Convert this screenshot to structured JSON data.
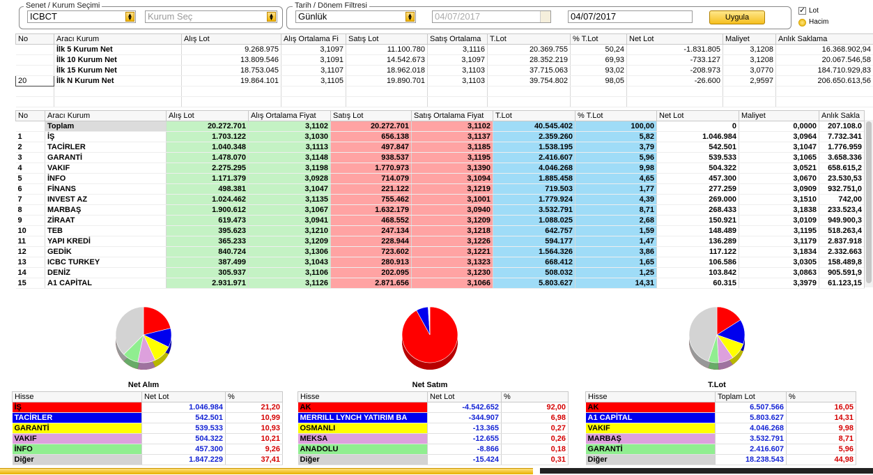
{
  "filters": {
    "security_group_title": "Senet / Kurum Seçimi",
    "security_value": "ICBCT",
    "institution_placeholder": "Kurum Seç",
    "date_group_title": "Tarih / Dönem Filtresi",
    "period_value": "Günlük",
    "start_date": "04/07/2017",
    "end_date": "04/07/2017",
    "apply_label": "Uygula",
    "option_lot_label": "Lot",
    "option_volume_label": "Hacim"
  },
  "top_table": {
    "columns": [
      "No",
      "Aracı Kurum",
      "Alış Lot",
      "Alış Ortalama Fi",
      "Satış Lot",
      "Satış Ortalama",
      "T.Lot",
      "% T.Lot",
      "Net Lot",
      "Maliyet",
      "Anlık Saklama"
    ],
    "rows": [
      {
        "no": "",
        "kurum": "İlk 5 Kurum Net",
        "alis_lot": "9.268.975",
        "alis_ort": "3,1097",
        "satis_lot": "11.100.780",
        "satis_ort": "3,1116",
        "t_lot": "20.369.755",
        "pct": "50,24",
        "net_lot": "-1.831.805",
        "maliyet": "3,1208",
        "saklama": "16.368.902,94"
      },
      {
        "no": "",
        "kurum": "İlk 10 Kurum Net",
        "alis_lot": "13.809.546",
        "alis_ort": "3,1091",
        "satis_lot": "14.542.673",
        "satis_ort": "3,1097",
        "t_lot": "28.352.219",
        "pct": "69,93",
        "net_lot": "-733.127",
        "maliyet": "3,1208",
        "saklama": "20.067.546,58"
      },
      {
        "no": "",
        "kurum": "İlk 15 Kurum Net",
        "alis_lot": "18.753.045",
        "alis_ort": "3,1107",
        "satis_lot": "18.962.018",
        "satis_ort": "3,1103",
        "t_lot": "37.715.063",
        "pct": "93,02",
        "net_lot": "-208.973",
        "maliyet": "3,0770",
        "saklama": "184.710.929,83"
      },
      {
        "no": "20",
        "kurum": "İlk N Kurum Net",
        "alis_lot": "19.864.101",
        "alis_ort": "3,1105",
        "satis_lot": "19.890.701",
        "satis_ort": "3,1103",
        "t_lot": "39.754.802",
        "pct": "98,05",
        "net_lot": "-26.600",
        "maliyet": "2,9597",
        "saklama": "206.650.613,56"
      }
    ]
  },
  "main_table": {
    "columns": [
      "No",
      "Aracı Kurum",
      "Alış Lot",
      "Alış Ortalama Fiyat",
      "Satış Lot",
      "Satış Ortalama Fiyat",
      "T.Lot",
      "% T.Lot",
      "Net Lot",
      "Maliyet",
      "Anlık Sakla"
    ],
    "total": {
      "no": "",
      "kurum": "Toplam",
      "alis_lot": "20.272.701",
      "alis_ort": "3,1102",
      "satis_lot": "20.272.701",
      "satis_ort": "3,1102",
      "t_lot": "40.545.402",
      "pct": "100,00",
      "net_lot": "0",
      "maliyet": "0,0000",
      "saklama": "207.108.0"
    },
    "rows": [
      {
        "no": "1",
        "kurum": "İŞ",
        "alis_lot": "1.703.122",
        "alis_ort": "3,1030",
        "satis_lot": "656.138",
        "satis_ort": "3,1137",
        "t_lot": "2.359.260",
        "pct": "5,82",
        "net_lot": "1.046.984",
        "maliyet": "3,0964",
        "saklama": "7.732.341"
      },
      {
        "no": "2",
        "kurum": "TACİRLER",
        "alis_lot": "1.040.348",
        "alis_ort": "3,1113",
        "satis_lot": "497.847",
        "satis_ort": "3,1185",
        "t_lot": "1.538.195",
        "pct": "3,79",
        "net_lot": "542.501",
        "maliyet": "3,1047",
        "saklama": "1.776.959"
      },
      {
        "no": "3",
        "kurum": "GARANTİ",
        "alis_lot": "1.478.070",
        "alis_ort": "3,1148",
        "satis_lot": "938.537",
        "satis_ort": "3,1195",
        "t_lot": "2.416.607",
        "pct": "5,96",
        "net_lot": "539.533",
        "maliyet": "3,1065",
        "saklama": "3.658.336"
      },
      {
        "no": "4",
        "kurum": "VAKIF",
        "alis_lot": "2.275.295",
        "alis_ort": "3,1198",
        "satis_lot": "1.770.973",
        "satis_ort": "3,1390",
        "t_lot": "4.046.268",
        "pct": "9,98",
        "net_lot": "504.322",
        "maliyet": "3,0521",
        "saklama": "658.615,2"
      },
      {
        "no": "5",
        "kurum": "İNFO",
        "alis_lot": "1.171.379",
        "alis_ort": "3,0928",
        "satis_lot": "714.079",
        "satis_ort": "3,1094",
        "t_lot": "1.885.458",
        "pct": "4,65",
        "net_lot": "457.300",
        "maliyet": "3,0670",
        "saklama": "23.530,53"
      },
      {
        "no": "6",
        "kurum": "FİNANS",
        "alis_lot": "498.381",
        "alis_ort": "3,1047",
        "satis_lot": "221.122",
        "satis_ort": "3,1219",
        "t_lot": "719.503",
        "pct": "1,77",
        "net_lot": "277.259",
        "maliyet": "3,0909",
        "saklama": "932.751,0"
      },
      {
        "no": "7",
        "kurum": "INVEST AZ",
        "alis_lot": "1.024.462",
        "alis_ort": "3,1135",
        "satis_lot": "755.462",
        "satis_ort": "3,1001",
        "t_lot": "1.779.924",
        "pct": "4,39",
        "net_lot": "269.000",
        "maliyet": "3,1510",
        "saklama": "742,00"
      },
      {
        "no": "8",
        "kurum": "MARBAŞ",
        "alis_lot": "1.900.612",
        "alis_ort": "3,1067",
        "satis_lot": "1.632.179",
        "satis_ort": "3,0940",
        "t_lot": "3.532.791",
        "pct": "8,71",
        "net_lot": "268.433",
        "maliyet": "3,1838",
        "saklama": "233.523,4"
      },
      {
        "no": "9",
        "kurum": "ZİRAAT",
        "alis_lot": "619.473",
        "alis_ort": "3,0941",
        "satis_lot": "468.552",
        "satis_ort": "3,1209",
        "t_lot": "1.088.025",
        "pct": "2,68",
        "net_lot": "150.921",
        "maliyet": "3,0109",
        "saklama": "949.900,3"
      },
      {
        "no": "10",
        "kurum": "TEB",
        "alis_lot": "395.623",
        "alis_ort": "3,1210",
        "satis_lot": "247.134",
        "satis_ort": "3,1218",
        "t_lot": "642.757",
        "pct": "1,59",
        "net_lot": "148.489",
        "maliyet": "3,1195",
        "saklama": "518.263,4"
      },
      {
        "no": "11",
        "kurum": "YAPI KREDİ",
        "alis_lot": "365.233",
        "alis_ort": "3,1209",
        "satis_lot": "228.944",
        "satis_ort": "3,1226",
        "t_lot": "594.177",
        "pct": "1,47",
        "net_lot": "136.289",
        "maliyet": "3,1179",
        "saklama": "2.837.918"
      },
      {
        "no": "12",
        "kurum": "GEDİK",
        "alis_lot": "840.724",
        "alis_ort": "3,1306",
        "satis_lot": "723.602",
        "satis_ort": "3,1221",
        "t_lot": "1.564.326",
        "pct": "3,86",
        "net_lot": "117.122",
        "maliyet": "3,1834",
        "saklama": "2.332.663"
      },
      {
        "no": "13",
        "kurum": "ICBC TURKEY",
        "alis_lot": "387.499",
        "alis_ort": "3,1043",
        "satis_lot": "280.913",
        "satis_ort": "3,1323",
        "t_lot": "668.412",
        "pct": "1,65",
        "net_lot": "106.586",
        "maliyet": "3,0305",
        "saklama": "158.489,8"
      },
      {
        "no": "14",
        "kurum": "DENİZ",
        "alis_lot": "305.937",
        "alis_ort": "3,1106",
        "satis_lot": "202.095",
        "satis_ort": "3,1230",
        "t_lot": "508.032",
        "pct": "1,25",
        "net_lot": "103.842",
        "maliyet": "3,0863",
        "saklama": "905.591,9"
      },
      {
        "no": "15",
        "kurum": "A1 CAPİTAL",
        "alis_lot": "2.931.971",
        "alis_ort": "3,1126",
        "satis_lot": "2.871.656",
        "satis_ort": "3,1066",
        "t_lot": "5.803.627",
        "pct": "14,31",
        "net_lot": "60.315",
        "maliyet": "3,3979",
        "saklama": "61.123,15"
      }
    ]
  },
  "palette": {
    "c1": "#ff0000",
    "c2": "#0000ee",
    "c3": "#ffff00",
    "c4": "#dda0dd",
    "c5": "#90ee90",
    "c6": "#d3d3d3"
  },
  "summaries": [
    {
      "title": "Net Alım",
      "col1": "Hisse",
      "col2": "Net Lot",
      "col3": "%",
      "rows": [
        {
          "name": "İŞ",
          "lot": "1.046.984",
          "pct": "21,20",
          "share": 21.2
        },
        {
          "name": "TACİRLER",
          "lot": "542.501",
          "pct": "10,99",
          "share": 10.99
        },
        {
          "name": "GARANTİ",
          "lot": "539.533",
          "pct": "10,93",
          "share": 10.93
        },
        {
          "name": "VAKIF",
          "lot": "504.322",
          "pct": "10,21",
          "share": 10.21
        },
        {
          "name": "İNFO",
          "lot": "457.300",
          "pct": "9,26",
          "share": 9.26
        },
        {
          "name": "Diğer",
          "lot": "1.847.229",
          "pct": "37,41",
          "share": 37.41
        }
      ]
    },
    {
      "title": "Net Satım",
      "col1": "Hisse",
      "col2": "Net Lot",
      "col3": "%",
      "rows": [
        {
          "name": "AK",
          "lot": "-4.542.652",
          "pct": "92,00",
          "share": 92.0
        },
        {
          "name": "MERRILL LYNCH YATIRIM BA",
          "lot": "-344.907",
          "pct": "6,98",
          "share": 6.98
        },
        {
          "name": "OSMANLI",
          "lot": "-13.365",
          "pct": "0,27",
          "share": 0.27
        },
        {
          "name": "MEKSA",
          "lot": "-12.655",
          "pct": "0,26",
          "share": 0.26
        },
        {
          "name": "ANADOLU",
          "lot": "-8.866",
          "pct": "0,18",
          "share": 0.18
        },
        {
          "name": "Diğer",
          "lot": "-15.424",
          "pct": "0,31",
          "share": 0.31
        }
      ]
    },
    {
      "title": "T.Lot",
      "col1": "Hisse",
      "col2": "Toplam Lot",
      "col3": "%",
      "rows": [
        {
          "name": "AK",
          "lot": "6.507.566",
          "pct": "16,05",
          "share": 16.05
        },
        {
          "name": "A1 CAPİTAL",
          "lot": "5.803.627",
          "pct": "14,31",
          "share": 14.31
        },
        {
          "name": "VAKIF",
          "lot": "4.046.268",
          "pct": "9,98",
          "share": 9.98
        },
        {
          "name": "MARBAŞ",
          "lot": "3.532.791",
          "pct": "8,71",
          "share": 8.71
        },
        {
          "name": "GARANTİ",
          "lot": "2.416.607",
          "pct": "5,96",
          "share": 5.96
        },
        {
          "name": "Diğer",
          "lot": "18.238.543",
          "pct": "44,98",
          "share": 44.98
        }
      ]
    }
  ]
}
